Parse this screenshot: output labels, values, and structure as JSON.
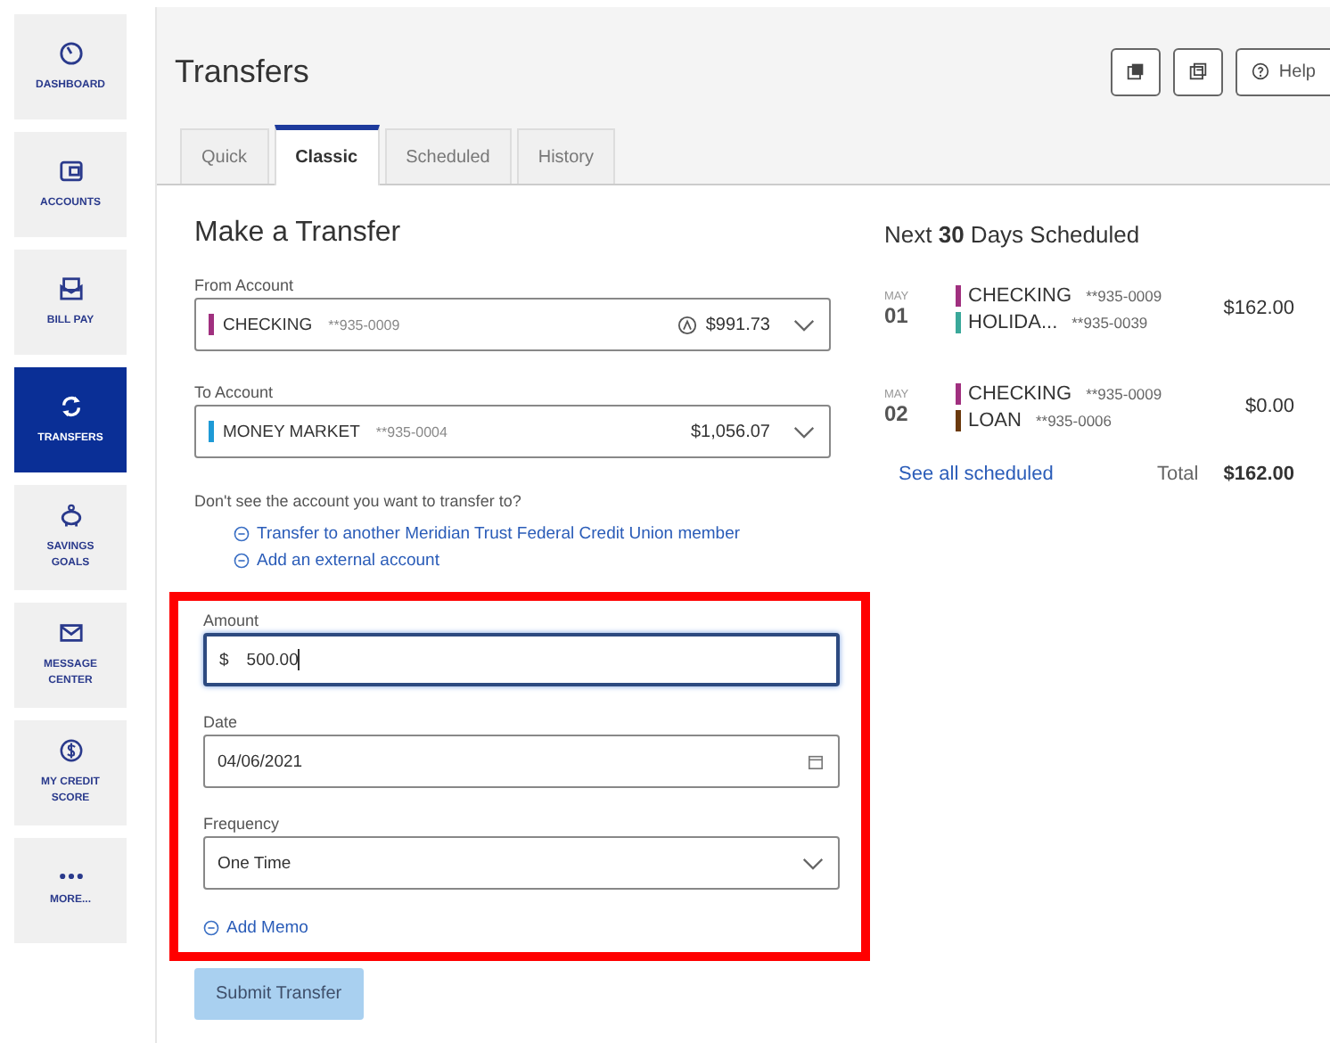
{
  "sidebar": {
    "items": [
      {
        "label": "DASHBOARD",
        "selected": false
      },
      {
        "label": "ACCOUNTS",
        "selected": false
      },
      {
        "label": "BILL PAY",
        "selected": false
      },
      {
        "label": "TRANSFERS",
        "selected": true
      },
      {
        "label": "SAVINGS GOALS",
        "selected": false
      },
      {
        "label": "MESSAGE CENTER",
        "selected": false
      },
      {
        "label": "MY CREDIT SCORE",
        "selected": false
      },
      {
        "label": "MORE...",
        "selected": false
      }
    ]
  },
  "header": {
    "title": "Transfers",
    "help_button": "Help"
  },
  "tabs": [
    {
      "label": "Quick",
      "selected": false
    },
    {
      "label": "Classic",
      "selected": true
    },
    {
      "label": "Scheduled",
      "selected": false
    },
    {
      "label": "History",
      "selected": false
    }
  ],
  "form": {
    "title": "Make a Transfer",
    "from_account": {
      "label": "From Account",
      "name": "CHECKING",
      "number": "**935-0009",
      "balance": "$991.73",
      "color": "#a0307f",
      "available_icon": true
    },
    "to_account": {
      "label": "To Account",
      "name": "MONEY MARKET",
      "number": "**935-0004",
      "balance": "$1,056.07",
      "color": "#1e9ad6",
      "available_icon": false
    },
    "note": "Don't see the account you want to transfer to?",
    "links": [
      "Transfer to another Meridian Trust Federal Credit Union member",
      "Add an external account"
    ],
    "highlighted": true,
    "amount": {
      "label": "Amount",
      "prefix": "$",
      "value": "500.00",
      "focused": true
    },
    "date": {
      "label": "Date",
      "value": "04/06/2021"
    },
    "frequency": {
      "label": "Frequency",
      "value": "One Time"
    },
    "add_memo": "Add Memo",
    "submit_button": {
      "label": "Submit Transfer",
      "disabled": true
    }
  },
  "scheduled": {
    "title": "Next **30** Days Scheduled",
    "entries": [
      {
        "month": "MAY",
        "day": "01",
        "amount": "$162.00",
        "accounts": [
          {
            "name": "CHECKING",
            "number": "**935-0009",
            "color": "#a0307f"
          },
          {
            "name": "HOLIDA...",
            "number": "**935-0039",
            "color": "#3aa89a"
          }
        ]
      },
      {
        "month": "MAY",
        "day": "02",
        "amount": "$0.00",
        "accounts": [
          {
            "name": "CHECKING",
            "number": "**935-0009",
            "color": "#a0307f"
          },
          {
            "name": "LOAN",
            "number": "**935-0006",
            "color": "#6b3a0e"
          }
        ]
      }
    ],
    "see_all_link": "See all scheduled",
    "total_label": "Total",
    "total": "$162.00"
  }
}
